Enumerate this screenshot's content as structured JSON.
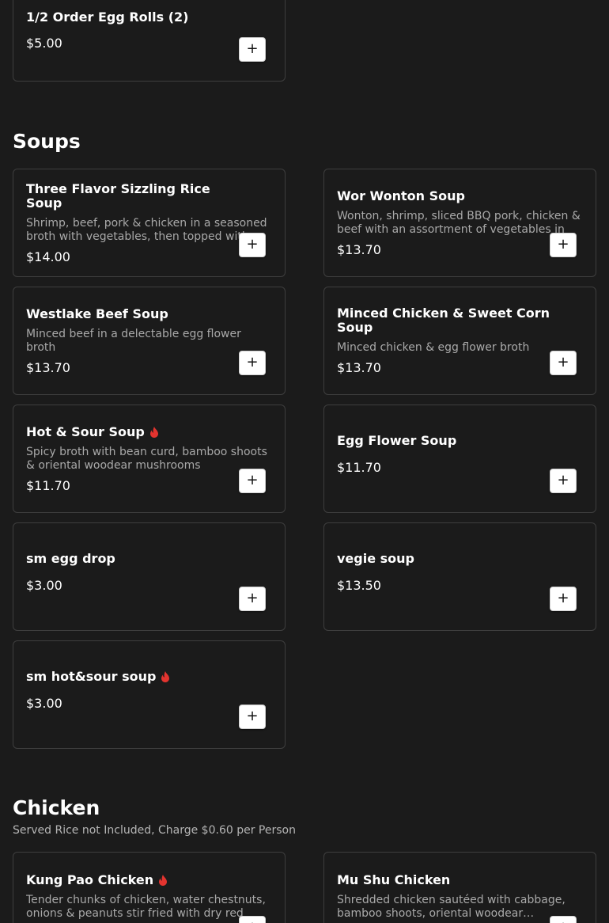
{
  "colors": {
    "background": "#1b1b1b",
    "card_border": "#3e3e3e",
    "spicy": "#e3342f",
    "muted": "#a9a9a9"
  },
  "top_item": {
    "title": "1/2 Order Egg Rolls (2)",
    "price": "$5.00",
    "add_label": "+"
  },
  "soups": {
    "heading": "Soups",
    "items": [
      {
        "title": "Three Flavor Sizzling Rice Soup",
        "desc": "Shrimp, beef, pork & chicken in a seasoned broth with vegetables, then topped with sizzling rice",
        "price": "$14.00",
        "spicy": false
      },
      {
        "title": "Wor Wonton Soup",
        "desc": "Wonton, shrimp, sliced BBQ pork, chicken & beef with an assortment of vegetables in broth",
        "price": "$13.70",
        "spicy": false
      },
      {
        "title": "Westlake Beef Soup",
        "desc": "Minced beef in a delectable egg flower broth",
        "price": "$13.70",
        "spicy": false
      },
      {
        "title": "Minced Chicken & Sweet Corn Soup",
        "desc": "Minced chicken & egg flower broth",
        "price": "$13.70",
        "spicy": false
      },
      {
        "title": "Hot & Sour Soup",
        "desc": "Spicy broth with bean curd, bamboo shoots & oriental woodear mushrooms",
        "price": "$11.70",
        "spicy": true
      },
      {
        "title": "Egg Flower Soup",
        "desc": "",
        "price": "$11.70",
        "spicy": false
      },
      {
        "title": "sm egg drop",
        "desc": "",
        "price": "$3.00",
        "spicy": false
      },
      {
        "title": "vegie soup",
        "desc": "",
        "price": "$13.50",
        "spicy": false
      },
      {
        "title": "sm hot&sour soup",
        "desc": "",
        "price": "$3.00",
        "spicy": true
      }
    ]
  },
  "chicken": {
    "heading": "Chicken",
    "subheading": "Served Rice not Included, Charge $0.60 per Person",
    "items": [
      {
        "title": "Kung Pao Chicken",
        "desc": "Tender chunks of chicken, water chestnuts, onions & peanuts stir fried with dry red peppers",
        "price": "",
        "spicy": true
      },
      {
        "title": "Mu Shu Chicken",
        "desc": "Shredded chicken sautéed with cabbage, bamboo shoots, oriental woodear…",
        "price": "",
        "spicy": false
      }
    ]
  }
}
